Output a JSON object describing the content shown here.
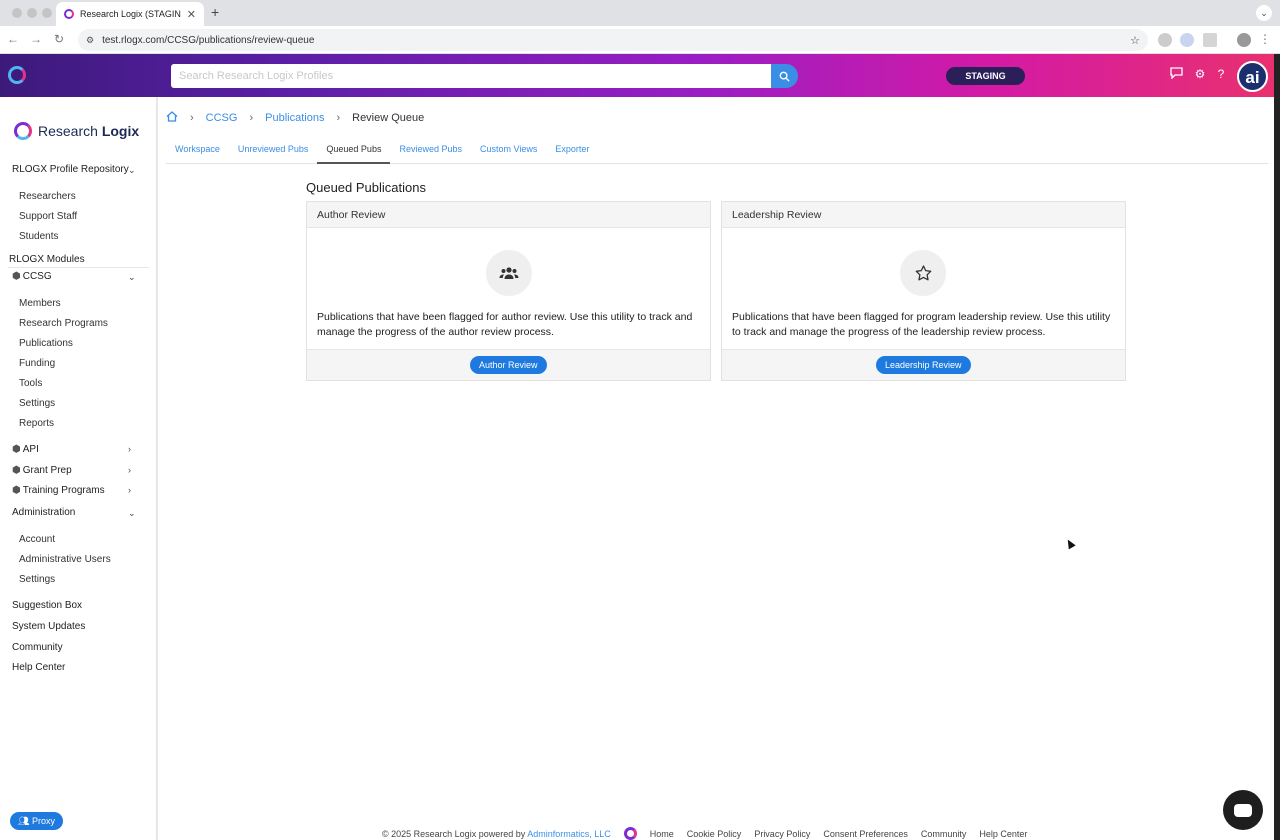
{
  "browser": {
    "tab_title": "Research Logix (STAGING)",
    "url": "test.rlogx.com/CCSG/publications/review-queue"
  },
  "header": {
    "search_placeholder": "Search Research Logix Profiles",
    "env_label": "STAGING",
    "avatar_text": "ai"
  },
  "sidebar": {
    "brand_a": "Research ",
    "brand_b": "Logix",
    "repo_label": "RLOGX Profile Repository",
    "repo_items": [
      "Researchers",
      "Support Staff",
      "Students"
    ],
    "modules_label": "RLOGX Modules",
    "ccsg_label": "CCSG",
    "ccsg_items": [
      "Members",
      "Research Programs",
      "Publications",
      "Funding",
      "Tools",
      "Settings",
      "Reports"
    ],
    "api_label": "API",
    "grant_prep_label": "Grant Prep",
    "training_label": "Training Programs",
    "admin_label": "Administration",
    "admin_items": [
      "Account",
      "Administrative Users",
      "Settings"
    ],
    "bottom_links": [
      "Suggestion Box",
      "System Updates",
      "Community",
      "Help Center"
    ],
    "proxy_label": "Proxy"
  },
  "breadcrumb": [
    "CCSG",
    "Publications",
    "Review Queue"
  ],
  "tabs": [
    "Workspace",
    "Unreviewed Pubs",
    "Queued Pubs",
    "Reviewed Pubs",
    "Custom Views",
    "Exporter"
  ],
  "active_tab": "Queued Pubs",
  "page_title": "Queued Publications",
  "cards": [
    {
      "title": "Author Review",
      "icon": "users-icon",
      "description": "Publications that have been flagged for author review. Use this utility to track and manage the progress of the author review process.",
      "button": "Author Review"
    },
    {
      "title": "Leadership Review",
      "icon": "star-icon",
      "description": "Publications that have been flagged for program leadership review. Use this utility to track and manage the progress of the leadership review process.",
      "button": "Leadership Review"
    }
  ],
  "footer": {
    "copyright": "© 2025 Research Logix powered by",
    "company": "Adminformatics, LLC",
    "links": [
      "Home",
      "Cookie Policy",
      "Privacy Policy",
      "Consent Preferences",
      "Community",
      "Help Center"
    ]
  },
  "colors": {
    "accent": "#3a8ee6",
    "button": "#1f7ae0",
    "header_gradient_start": "#3c1a7a",
    "header_gradient_end": "#e83070"
  }
}
